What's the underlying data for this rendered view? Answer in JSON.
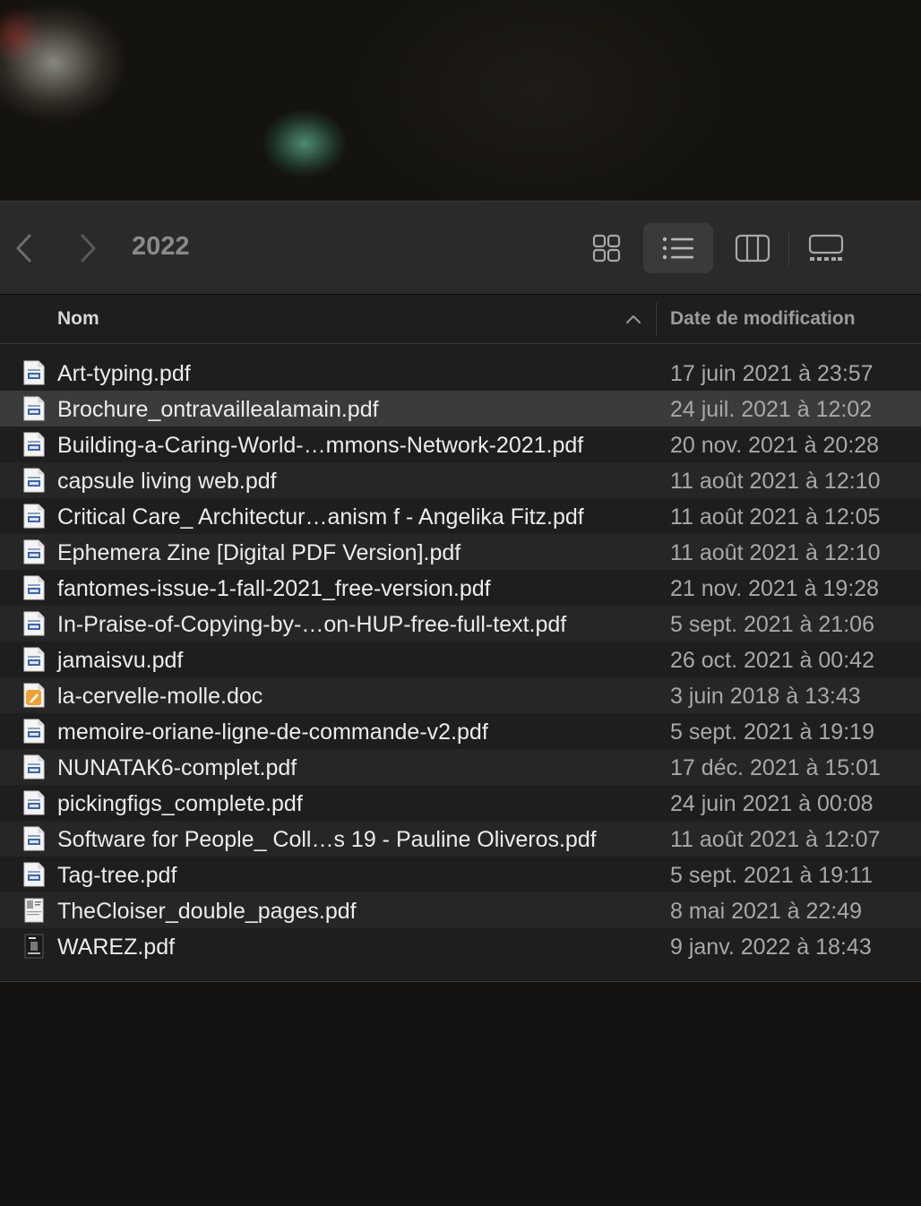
{
  "window": {
    "title": "2022",
    "columns": {
      "name": "Nom",
      "date": "Date de modification"
    },
    "files": [
      {
        "name": "Art-typing.pdf",
        "date": "17 juin 2021 à 23:57",
        "icon": "pdf-file-icon"
      },
      {
        "name": "Brochure_ontravaillealamain.pdf",
        "date": "24 juil. 2021 à 12:02",
        "icon": "pdf-file-icon"
      },
      {
        "name": "Building-a-Caring-World-…mmons-Network-2021.pdf",
        "date": "20 nov. 2021 à 20:28",
        "icon": "pdf-file-icon"
      },
      {
        "name": "capsule living web.pdf",
        "date": "11 août 2021 à 12:10",
        "icon": "pdf-file-icon"
      },
      {
        "name": "Critical Care_ Architectur…anism f - Angelika Fitz.pdf",
        "date": "11 août 2021 à 12:05",
        "icon": "pdf-file-icon"
      },
      {
        "name": "Ephemera Zine [Digital PDF Version].pdf",
        "date": "11 août 2021 à 12:10",
        "icon": "pdf-file-icon"
      },
      {
        "name": "fantomes-issue-1-fall-2021_free-version.pdf",
        "date": "21 nov. 2021 à 19:28",
        "icon": "pdf-file-icon"
      },
      {
        "name": "In-Praise-of-Copying-by-…on-HUP-free-full-text.pdf",
        "date": "5 sept. 2021 à 21:06",
        "icon": "pdf-file-icon"
      },
      {
        "name": "jamaisvu.pdf",
        "date": "26 oct. 2021 à 00:42",
        "icon": "pdf-file-icon"
      },
      {
        "name": "la-cervelle-molle.doc",
        "date": "3 juin 2018 à 13:43",
        "icon": "doc-file-icon"
      },
      {
        "name": "memoire-oriane-ligne-de-commande-v2.pdf",
        "date": "5 sept. 2021 à 19:19",
        "icon": "pdf-file-icon"
      },
      {
        "name": "NUNATAK6-complet.pdf",
        "date": "17 déc. 2021 à 15:01",
        "icon": "pdf-file-icon"
      },
      {
        "name": "pickingfigs_complete.pdf",
        "date": "24 juin 2021 à 00:08",
        "icon": "pdf-file-icon"
      },
      {
        "name": "Software for People_ Coll…s 19 - Pauline Oliveros.pdf",
        "date": "11 août 2021 à 12:07",
        "icon": "pdf-file-icon"
      },
      {
        "name": "Tag-tree.pdf",
        "date": "5 sept. 2021 à 19:11",
        "icon": "pdf-file-icon"
      },
      {
        "name": "TheCloiser_double_pages.pdf",
        "date": "8 mai 2021 à 22:49",
        "icon": "pdf-thumbnail-light-icon"
      },
      {
        "name": "WAREZ.pdf",
        "date": "9 janv. 2022 à 18:43",
        "icon": "pdf-thumbnail-dark-icon"
      }
    ],
    "selected_index": 1
  },
  "colors": {
    "selection": "#3b3b3b",
    "window_bg": "#1e1e1e",
    "toolbar_bg": "#2a2a2a",
    "doc_icon": "#f0a030"
  }
}
